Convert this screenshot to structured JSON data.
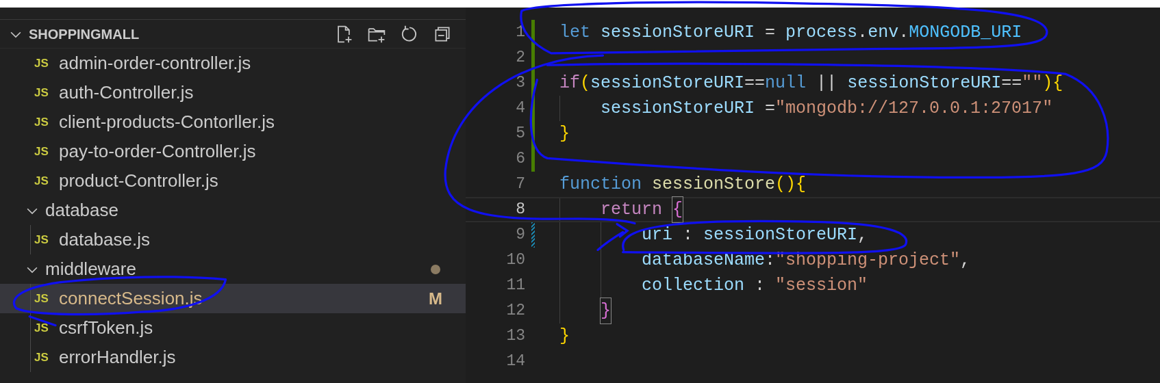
{
  "explorer": {
    "title": "SHOPPINGMALL",
    "expanded": true,
    "items": [
      {
        "kind": "file",
        "label": "admin-order-controller.js",
        "type_badge": "JS",
        "selected": false
      },
      {
        "kind": "file",
        "label": "auth-Controller.js",
        "type_badge": "JS",
        "selected": false
      },
      {
        "kind": "file",
        "label": "client-products-Contorller.js",
        "type_badge": "JS",
        "selected": false
      },
      {
        "kind": "file",
        "label": "pay-to-order-Controller.js",
        "type_badge": "JS",
        "selected": false
      },
      {
        "kind": "file",
        "label": "product-Controller.js",
        "type_badge": "JS",
        "selected": false
      },
      {
        "kind": "folder",
        "label": "database",
        "expanded": true,
        "modified": false,
        "selected": false,
        "children": [
          {
            "kind": "file",
            "label": "database.js",
            "type_badge": "JS",
            "selected": false
          }
        ]
      },
      {
        "kind": "folder",
        "label": "middleware",
        "expanded": true,
        "modified": true,
        "selected": false,
        "children": [
          {
            "kind": "file",
            "label": "connectSession.js",
            "type_badge": "JS",
            "selected": true,
            "git_status": "M"
          },
          {
            "kind": "file",
            "label": "csrfToken.js",
            "type_badge": "JS",
            "selected": false
          },
          {
            "kind": "file",
            "label": "errorHandler.js",
            "type_badge": "JS",
            "selected": false
          }
        ]
      }
    ]
  },
  "editor": {
    "lines": [
      {
        "number": "1",
        "current": false,
        "added": true,
        "modified": false,
        "tokens": [
          {
            "text": "let",
            "kind": "keyword"
          },
          {
            "text": "sessionStoreURI",
            "kind": "variable",
            "space_before": true
          },
          {
            "text": "=",
            "kind": "plain",
            "space_before": true
          },
          {
            "text": "process",
            "kind": "variable",
            "space_before": true
          },
          {
            "text": ".",
            "kind": "plain"
          },
          {
            "text": "env",
            "kind": "variable"
          },
          {
            "text": ".",
            "kind": "plain"
          },
          {
            "text": "MONGODB_URI",
            "kind": "constant"
          }
        ]
      },
      {
        "number": "2",
        "current": false,
        "added": true,
        "modified": false
      },
      {
        "number": "3",
        "current": false,
        "added": true,
        "modified": false,
        "tokens": [
          {
            "text": "if",
            "kind": "control"
          },
          {
            "text": "(",
            "kind": "bracket1"
          },
          {
            "text": "sessionStoreURI",
            "kind": "variable"
          },
          {
            "text": "==",
            "kind": "plain"
          },
          {
            "text": "null",
            "kind": "keyword"
          },
          {
            "text": "||",
            "kind": "plain",
            "space_before": true
          },
          {
            "text": "sessionStoreURI",
            "kind": "variable",
            "space_before": true
          },
          {
            "text": "==",
            "kind": "plain"
          },
          {
            "text": "\"\"",
            "kind": "string"
          },
          {
            "text": ")",
            "kind": "bracket1"
          },
          {
            "text": "{",
            "kind": "bracket1"
          }
        ]
      },
      {
        "number": "4",
        "current": false,
        "added": true,
        "modified": false,
        "tokens": [
          {
            "kind": "indent"
          },
          {
            "text": "sessionStoreURI",
            "kind": "variable"
          },
          {
            "text": "=",
            "kind": "plain",
            "space_before": true
          },
          {
            "text": "\"mongodb://127.0.0.1:27017\"",
            "kind": "string"
          }
        ]
      },
      {
        "number": "5",
        "current": false,
        "added": true,
        "modified": false,
        "tokens": [
          {
            "text": "}",
            "kind": "bracket1"
          }
        ]
      },
      {
        "number": "6",
        "current": false,
        "added": true,
        "modified": false
      },
      {
        "number": "7",
        "current": false,
        "added": false,
        "modified": false,
        "tokens": [
          {
            "text": "function",
            "kind": "keyword"
          },
          {
            "text": "sessionStore",
            "kind": "function",
            "space_before": true
          },
          {
            "text": "()",
            "kind": "bracket1"
          },
          {
            "text": "{",
            "kind": "bracket1"
          }
        ]
      },
      {
        "number": "8",
        "current": true,
        "added": false,
        "modified": false,
        "tokens": [
          {
            "kind": "indent"
          },
          {
            "text": "return",
            "kind": "control"
          },
          {
            "text": "{",
            "kind": "bracket2",
            "space_before": true,
            "matched": true
          }
        ]
      },
      {
        "number": "9",
        "current": false,
        "added": false,
        "modified": true,
        "tokens": [
          {
            "kind": "indent"
          },
          {
            "kind": "indent"
          },
          {
            "text": "uri",
            "kind": "variable"
          },
          {
            "text": ":",
            "kind": "plain",
            "space_before": true
          },
          {
            "text": "sessionStoreURI",
            "kind": "variable",
            "space_before": true
          },
          {
            "text": ",",
            "kind": "plain"
          }
        ]
      },
      {
        "number": "10",
        "current": false,
        "added": false,
        "modified": false,
        "tokens": [
          {
            "kind": "indent"
          },
          {
            "kind": "indent"
          },
          {
            "text": "databaseName",
            "kind": "variable"
          },
          {
            "text": ":",
            "kind": "plain"
          },
          {
            "text": "\"shopping-project\"",
            "kind": "string"
          },
          {
            "text": ",",
            "kind": "plain"
          }
        ]
      },
      {
        "number": "11",
        "current": false,
        "added": false,
        "modified": false,
        "tokens": [
          {
            "kind": "indent"
          },
          {
            "kind": "indent"
          },
          {
            "text": "collection",
            "kind": "variable"
          },
          {
            "text": ":",
            "kind": "plain",
            "space_before": true
          },
          {
            "text": "\"session\"",
            "kind": "string",
            "space_before": true
          }
        ]
      },
      {
        "number": "12",
        "current": false,
        "added": false,
        "modified": false,
        "tokens": [
          {
            "kind": "indent"
          },
          {
            "text": "}",
            "kind": "bracket2",
            "matched": true
          }
        ]
      },
      {
        "number": "13",
        "current": false,
        "added": false,
        "modified": false,
        "tokens": [
          {
            "text": "}",
            "kind": "bracket1"
          }
        ]
      },
      {
        "number": "14",
        "current": false,
        "added": false,
        "modified": false
      }
    ]
  }
}
